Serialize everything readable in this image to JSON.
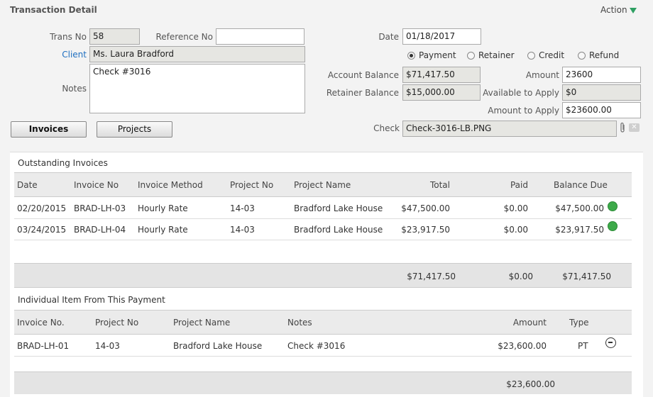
{
  "header": {
    "title": "Transaction Detail",
    "action_label": "Action"
  },
  "form": {
    "trans_no_label": "Trans No",
    "trans_no": "58",
    "reference_no_label": "Reference No",
    "reference_no": "",
    "client_label": "Client",
    "client": "Ms. Laura Bradford",
    "notes_label": "Notes",
    "notes": "Check #3016",
    "date_label": "Date",
    "date": "01/18/2017",
    "radios": [
      "Payment",
      "Retainer",
      "Credit",
      "Refund"
    ],
    "selected_type": "Payment",
    "account_balance_label": "Account Balance",
    "account_balance": "$71,417.50",
    "retainer_balance_label": "Retainer Balance",
    "retainer_balance": "$15,000.00",
    "amount_label": "Amount",
    "amount": "23600",
    "available_label": "Available to Apply",
    "available": "$0",
    "amount_to_apply_label": "Amount to Apply",
    "amount_to_apply": "$23600.00",
    "check_label": "Check",
    "check_file": "Check-3016-LB.PNG",
    "invoices_button": "Invoices",
    "projects_button": "Projects"
  },
  "outstanding": {
    "title": "Outstanding Invoices",
    "columns": [
      "Date",
      "Invoice No",
      "Invoice Method",
      "Project No",
      "Project Name",
      "Total",
      "Paid",
      "Balance Due"
    ],
    "rows": [
      [
        "02/20/2015",
        "BRAD-LH-03",
        "Hourly Rate",
        "14-03",
        "Bradford Lake House",
        "$47,500.00",
        "$0.00",
        "$47,500.00"
      ],
      [
        "03/24/2015",
        "BRAD-LH-04",
        "Hourly Rate",
        "14-03",
        "Bradford Lake House",
        "$23,917.50",
        "$0.00",
        "$23,917.50"
      ]
    ],
    "totals": {
      "total": "$71,417.50",
      "paid": "$0.00",
      "balance": "$71,417.50"
    }
  },
  "items": {
    "title": "Individual Item From This Payment",
    "columns": [
      "Invoice No.",
      "Project No",
      "Project Name",
      "Notes",
      "Amount",
      "Type"
    ],
    "rows": [
      [
        "BRAD-LH-01",
        "14-03",
        "Bradford Lake House",
        "Check #3016",
        "$23,600.00",
        "PT"
      ]
    ],
    "total": "$23,600.00"
  },
  "colors": {
    "accent": "#2e9f62",
    "link": "#1f6fc0",
    "check": "#3daa4a"
  },
  "icons": [
    "dropdown-triangle-icon",
    "paperclip-icon",
    "close-icon",
    "check-circle-icon",
    "minus-circle-icon"
  ]
}
